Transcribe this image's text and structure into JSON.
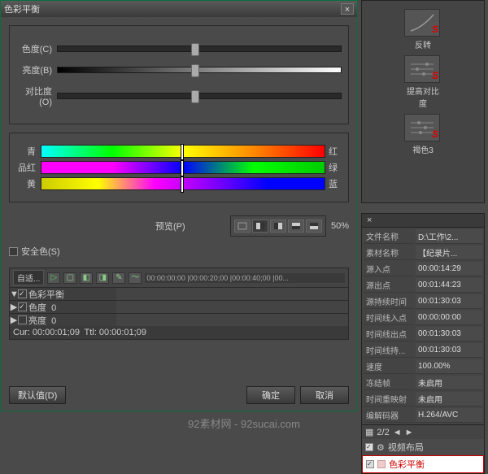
{
  "dialog": {
    "title": "色彩平衡",
    "close": "×",
    "sliders": {
      "chroma_label": "色度(C)",
      "brightness_label": "亮度(B)",
      "contrast_label": "对比度(O)"
    },
    "colors": {
      "cyan": "青",
      "red": "红",
      "magenta": "品红",
      "green": "绿",
      "yellow": "黄",
      "blue": "蓝"
    },
    "preview_label": "预览(P)",
    "preview_pct": "50%",
    "safe_color": "安全色(S)",
    "timeline": {
      "dropdown": "自适...",
      "ruler": "00:00:00;00   |00:00:20;00   |00:00:40;00   |00...",
      "tracks": [
        {
          "expand": "▼",
          "check": true,
          "name": "色彩平衡"
        },
        {
          "expand": "▶",
          "check": true,
          "name": "色度",
          "val": "0"
        },
        {
          "expand": "▶",
          "check": false,
          "name": "亮度",
          "val": "0"
        }
      ],
      "status_cur": "Cur: 00:00:01;09",
      "status_ttl": "Ttl: 00:00:01;09"
    },
    "buttons": {
      "default": "默认值(D)",
      "ok": "确定",
      "cancel": "取消"
    }
  },
  "effects": [
    {
      "name": "反转"
    },
    {
      "name": "提高对比度"
    },
    {
      "name": "褐色3"
    }
  ],
  "info": {
    "tab": "×",
    "rows": [
      {
        "k": "文件名称",
        "v": "D:\\工作\\2..."
      },
      {
        "k": "素材名称",
        "v": "【纪录片..."
      },
      {
        "k": "源入点",
        "v": "00:00:14:29"
      },
      {
        "k": "源出点",
        "v": "00:01:44:23"
      },
      {
        "k": "源持续时间",
        "v": "00:01:30:03"
      },
      {
        "k": "时间线入点",
        "v": "00:00:00:00"
      },
      {
        "k": "时间线出点",
        "v": "00:01:30:03"
      },
      {
        "k": "时间线持...",
        "v": "00:01:30:03"
      },
      {
        "k": "速度",
        "v": "100.00%"
      },
      {
        "k": "冻结帧",
        "v": "未启用"
      },
      {
        "k": "时间重映射",
        "v": "未启用"
      },
      {
        "k": "编解码器",
        "v": "H.264/AVC"
      }
    ],
    "pager": "2/2",
    "fx_head": "视频布局",
    "fx_row": "色彩平衡"
  },
  "watermark": "92素材网 - 92sucai.com"
}
